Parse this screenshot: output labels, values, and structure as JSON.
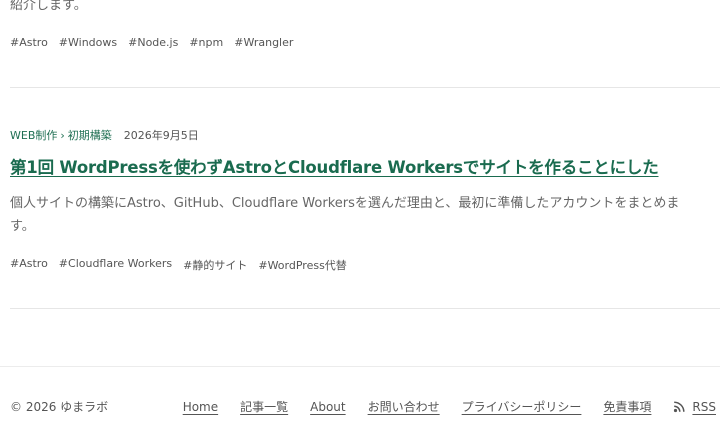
{
  "intro_tail": "紹介します。",
  "post1": {
    "tags": [
      "#Astro",
      "#Windows",
      "#Node.js",
      "#npm",
      "#Wrangler"
    ]
  },
  "post2": {
    "category": "WEB制作",
    "breadcrumb_sep": "›",
    "subcategory": "初期構築",
    "date": "2026年9月5日",
    "title": "第1回 WordPressを使わずAstroとCloudflare Workersでサイトを作ることにした",
    "excerpt": "個人サイトの構築にAstro、GitHub、Cloudflare Workersを選んだ理由と、最初に準備したアカウントをまとめます。",
    "tags": [
      "#Astro",
      "#Cloudflare Workers",
      "#静的サイト",
      "#WordPress代替"
    ]
  },
  "footer": {
    "copyright": "© 2026 ゆまラボ",
    "nav": {
      "home": "Home",
      "articles": "記事一覧",
      "about": "About",
      "contact": "お問い合わせ",
      "privacy": "プライバシーポリシー",
      "disclaimer": "免責事項",
      "rss": "RSS"
    },
    "rss_icon": "rss-icon"
  },
  "colors": {
    "accent": "#1a6b4f",
    "text": "#555555",
    "divider": "#e6e6e6"
  }
}
